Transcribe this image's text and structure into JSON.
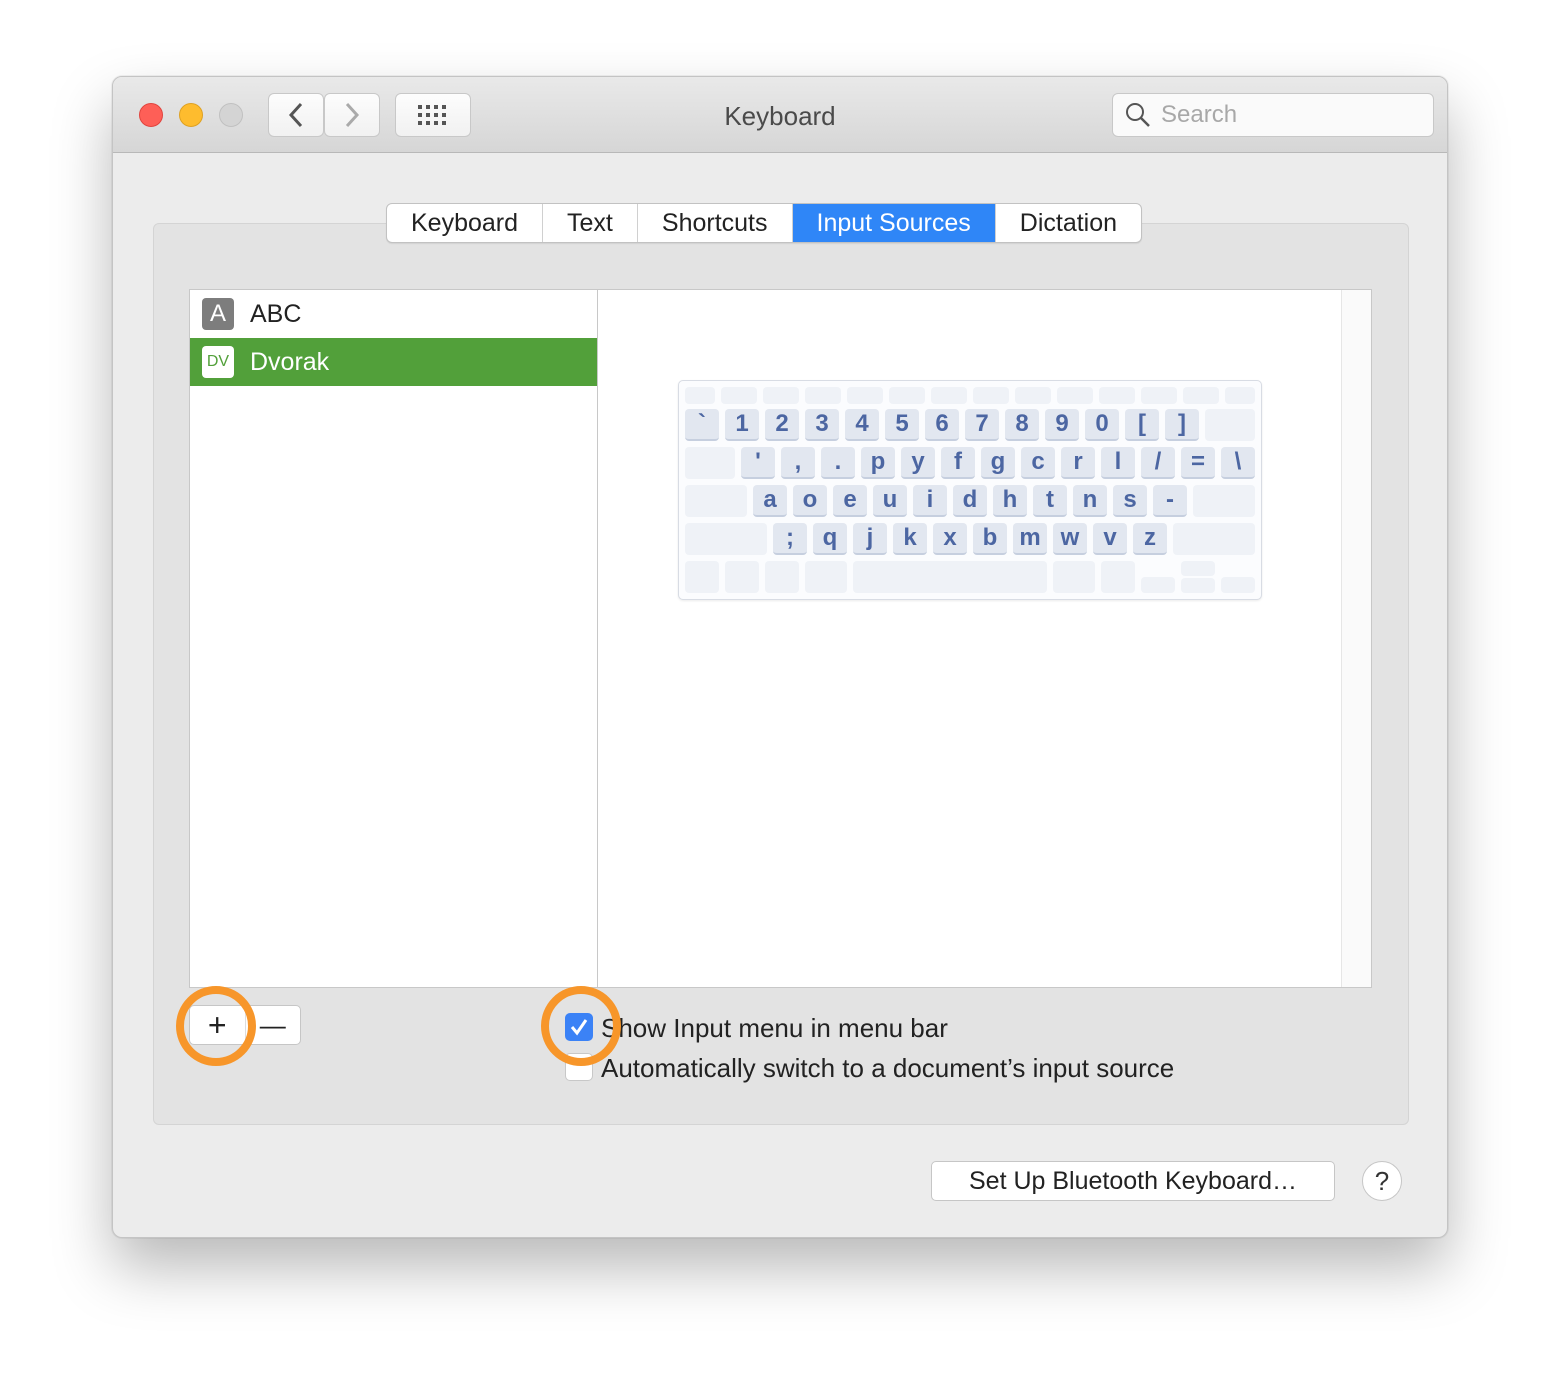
{
  "window": {
    "title": "Keyboard"
  },
  "toolbar": {
    "search_placeholder": "Search"
  },
  "colors": {
    "close": "#fe5f57",
    "minimize": "#febc2e",
    "zoom_disabled": "#d4d4d4",
    "accent": "#2f86f7",
    "selection": "#52a03a",
    "highlight_ring": "#f7962a",
    "key_label": "#4c66a2"
  },
  "tabs": [
    {
      "label": "Keyboard"
    },
    {
      "label": "Text"
    },
    {
      "label": "Shortcuts"
    },
    {
      "label": "Input Sources",
      "active": true
    },
    {
      "label": "Dictation"
    }
  ],
  "input_sources": [
    {
      "icon": "A",
      "label": "ABC",
      "selected": false
    },
    {
      "icon": "DV",
      "label": "Dvorak",
      "selected": true
    }
  ],
  "keyboard_layout": {
    "row1": [
      "`",
      "1",
      "2",
      "3",
      "4",
      "5",
      "6",
      "7",
      "8",
      "9",
      "0",
      "[",
      "]"
    ],
    "row2": [
      "'",
      ",",
      ".",
      "p",
      "y",
      "f",
      "g",
      "c",
      "r",
      "l",
      "/",
      "=",
      "\\"
    ],
    "row3": [
      "a",
      "o",
      "e",
      "u",
      "i",
      "d",
      "h",
      "t",
      "n",
      "s",
      "-"
    ],
    "row4": [
      ";",
      "q",
      "j",
      "k",
      "x",
      "b",
      "m",
      "w",
      "v",
      "z"
    ]
  },
  "list_controls": {
    "add": "+",
    "remove": "—"
  },
  "options": [
    {
      "label": "Show Input menu in menu bar",
      "checked": true
    },
    {
      "label": "Automatically switch to a document’s input source",
      "checked": false
    }
  ],
  "footer": {
    "bluetooth_button": "Set Up Bluetooth Keyboard…",
    "help": "?"
  }
}
